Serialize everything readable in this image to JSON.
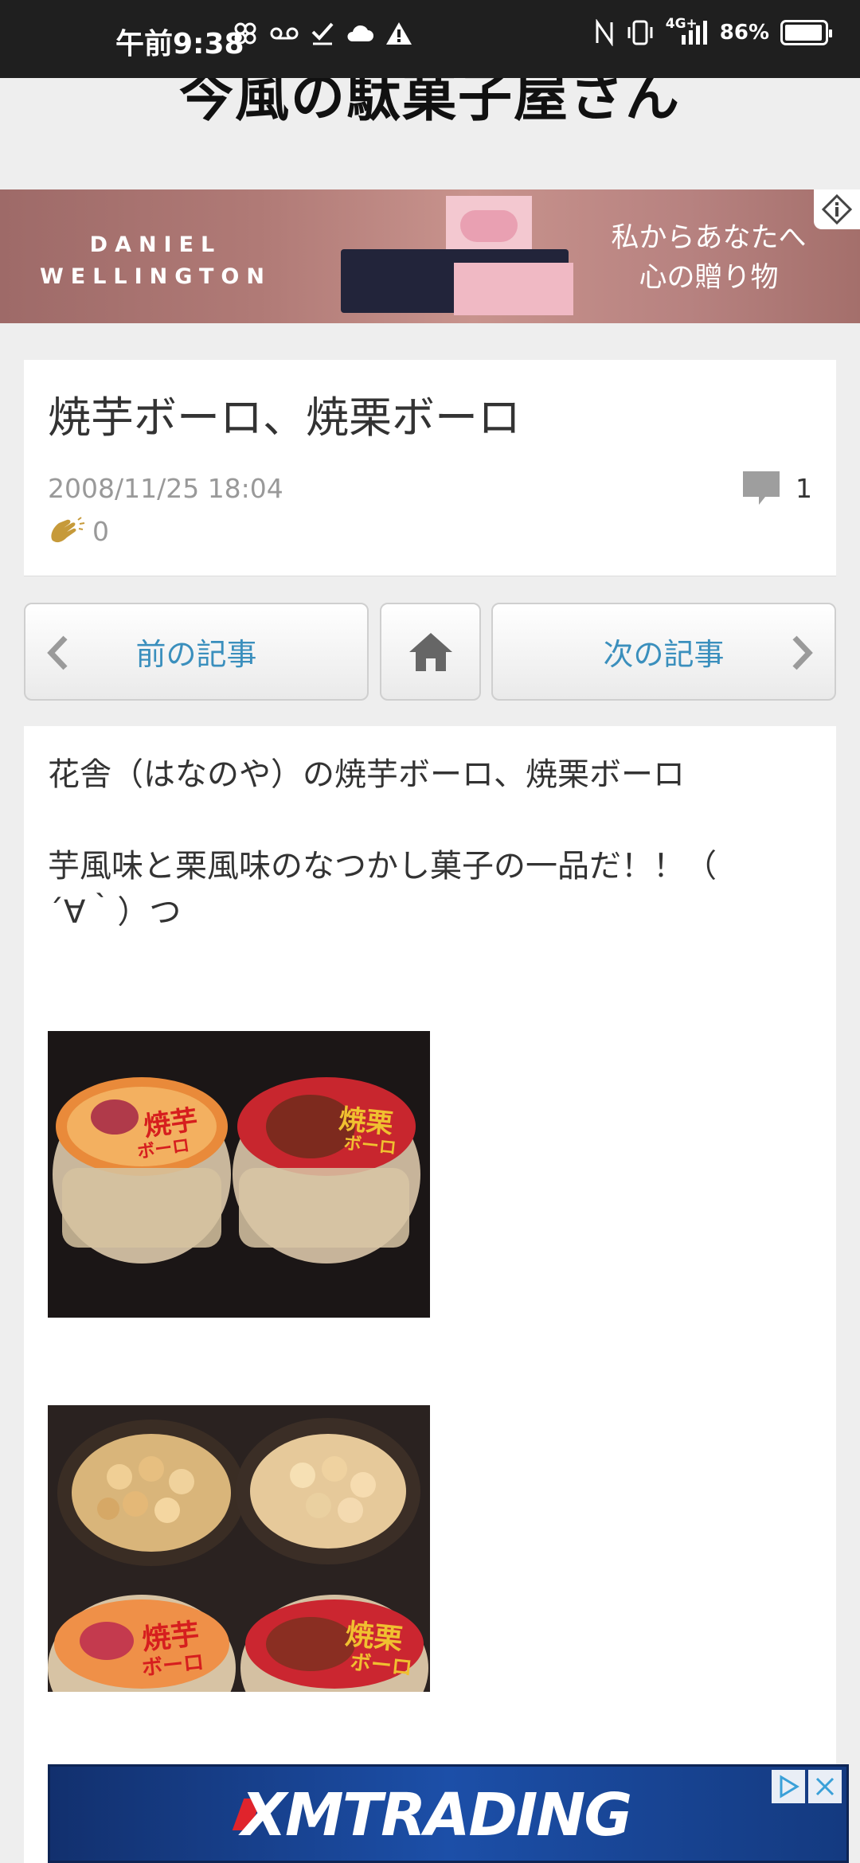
{
  "status_bar": {
    "time": "午前9:38",
    "network": "4G+",
    "battery_text": "86%",
    "battery_level": 0.86,
    "icons": [
      "pinwheel-icon",
      "voicemail-icon",
      "check-icon",
      "cloud-icon",
      "warning-icon",
      "nfc-icon",
      "vibrate-icon",
      "signal-icon",
      "battery-icon"
    ]
  },
  "site": {
    "title": "今風の駄菓子屋さん"
  },
  "ad_banner": {
    "brand_line1": "DANIEL",
    "brand_line2": "WELLINGTON",
    "copy_line1": "私からあなたへ",
    "copy_line2": "心の贈り物"
  },
  "article": {
    "title": "焼芋ボーロ、焼栗ボーロ",
    "date": "2008/11/25 18:04",
    "comment_count": "1",
    "clap_count": "0",
    "body": {
      "line1": "花舎（はなのや）の焼芋ボーロ、焼栗ボーロ",
      "line2": "芋風味と栗風味のなつかし菓子の一品だ！！（",
      "line3": "´∀｀）つ"
    }
  },
  "nav": {
    "prev_label": "前の記事",
    "next_label": "次の記事"
  },
  "photos": [
    {
      "label_left_1": "焼芋",
      "label_left_2": "ボーロ",
      "label_right_1": "焼栗",
      "label_right_2": "ボーロ"
    },
    {
      "label_left_1": "焼芋",
      "label_left_2": "ボーロ",
      "label_right_1": "焼栗",
      "label_right_2": "ボーロ"
    }
  ],
  "bottom_ad": {
    "logo": "XMTRADING"
  }
}
